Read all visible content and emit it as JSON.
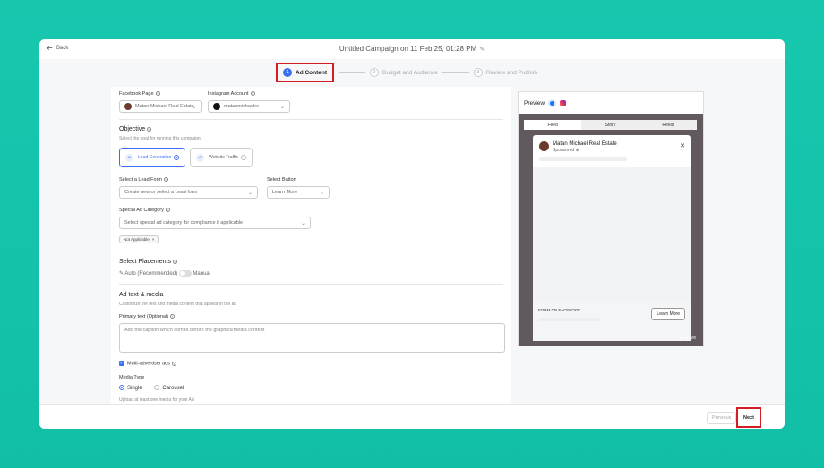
{
  "header": {
    "back_label": "Back",
    "campaign_title": "Untitled Campaign on 11 Feb 25, 01:28 PM"
  },
  "steps": [
    {
      "num": "1",
      "label": "Ad Content"
    },
    {
      "num": "2",
      "label": "Budget and Audience"
    },
    {
      "num": "3",
      "label": "Review and Publish"
    }
  ],
  "form": {
    "facebook_page_label": "Facebook Page",
    "facebook_page_value": "Matan Michael Real Estate",
    "instagram_label": "Instagram Account",
    "instagram_value": "matanmichaelre",
    "objective_title": "Objective",
    "objective_sub": "Select the goal for running this campaign",
    "objective_options": [
      "Lead Generation",
      "Website Traffic"
    ],
    "lead_form_label": "Select a Lead Form",
    "lead_form_placeholder": "Create new or select a Lead form",
    "button_label": "Select Button",
    "button_value": "Learn More",
    "special_label": "Special Ad Category",
    "special_placeholder": "Select special ad category for compliance if applicable",
    "special_chip": "Not Applicable",
    "placements_title": "Select Placements",
    "placements_auto": "Auto (Recommended)",
    "placements_manual": "Manual",
    "adtext_title": "Ad text & media",
    "adtext_sub": "Customize the text and media content that appear in the ad",
    "primary_label": "Primary text (Optional)",
    "primary_placeholder": "Add the caption which comes before the graphics/media content",
    "multi_adv": "Multi-advertiser ads",
    "media_type_label": "Media Type",
    "media_single": "Single",
    "media_carousel": "Carousel",
    "upload_hint": "Upload at least one media for your Ad"
  },
  "preview": {
    "title": "Preview",
    "tabs": [
      "Feed",
      "Story",
      "Reels"
    ],
    "page_name": "Matan Michael Real Estate",
    "sponsored": "Sponsored",
    "form_label": "FORM ON FACEBOOK",
    "cta": "Learn More",
    "share": "Share"
  },
  "footer": {
    "previous": "Previous",
    "next": "Next"
  }
}
